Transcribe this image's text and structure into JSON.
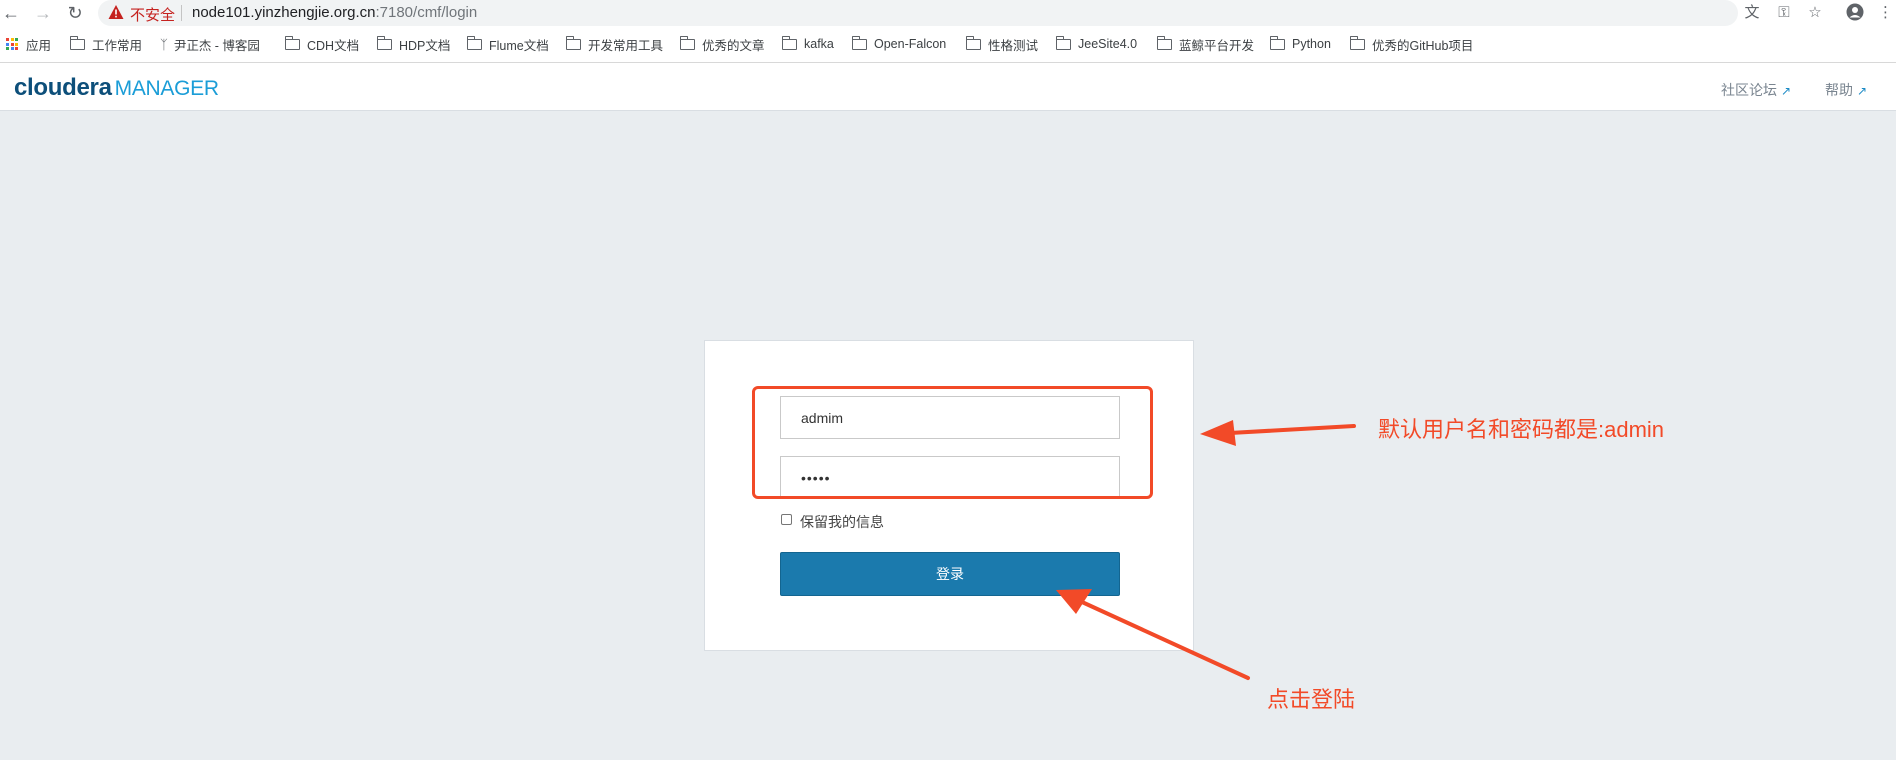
{
  "browser": {
    "insecure_label": "不安全",
    "url_host": "node101.yinzhengjie.org.cn",
    "url_rest": ":7180/cmf/login"
  },
  "bookmarks": [
    {
      "label": "应用",
      "icon": "apps-grid-icon"
    },
    {
      "label": "工作常用",
      "icon": "folder-icon"
    },
    {
      "label": "尹正杰 - 博客园",
      "icon": "site-icon"
    },
    {
      "label": "CDH文档",
      "icon": "folder-icon"
    },
    {
      "label": "HDP文档",
      "icon": "folder-icon"
    },
    {
      "label": "Flume文档",
      "icon": "folder-icon"
    },
    {
      "label": "开发常用工具",
      "icon": "folder-icon"
    },
    {
      "label": "优秀的文章",
      "icon": "folder-icon"
    },
    {
      "label": "kafka",
      "icon": "folder-icon"
    },
    {
      "label": "Open-Falcon",
      "icon": "folder-icon"
    },
    {
      "label": "性格测试",
      "icon": "folder-icon"
    },
    {
      "label": "JeeSite4.0",
      "icon": "folder-icon"
    },
    {
      "label": "蓝鲸平台开发",
      "icon": "folder-icon"
    },
    {
      "label": "Python",
      "icon": "folder-icon"
    },
    {
      "label": "优秀的GitHub项目",
      "icon": "folder-icon"
    }
  ],
  "header": {
    "logo_brand": "cloudera",
    "logo_product": "MANAGER",
    "community_link": "社区论坛",
    "help_link": "帮助"
  },
  "login": {
    "username_value": "admim",
    "password_value": "admin",
    "remember_label": "保留我的信息",
    "submit_label": "登录"
  },
  "annotations": {
    "credentials_note": "默认用户名和密码都是:admin",
    "click_note": "点击登陆"
  },
  "colors": {
    "annotation": "#f24a28",
    "login_button": "#1b7aad",
    "brand_dark": "#0d4f7a",
    "brand_light": "#1b9dd7"
  }
}
